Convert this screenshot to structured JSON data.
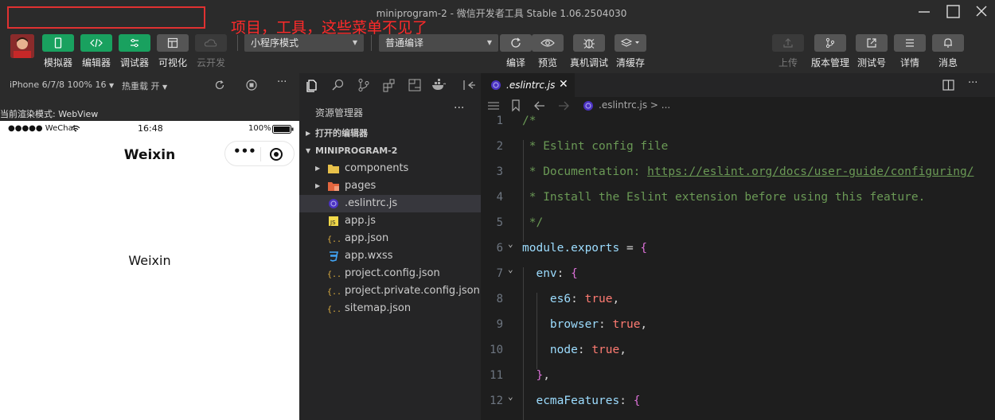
{
  "window": {
    "title": "miniprogram-2 - 微信开发者工具 Stable 1.06.2504030",
    "annotation": "项目，工具，这些菜单不见了"
  },
  "toolbar": {
    "left_buttons": [
      {
        "label": "模拟器",
        "icon": "phone-icon"
      },
      {
        "label": "编辑器",
        "icon": "code-icon"
      },
      {
        "label": "调试器",
        "icon": "debug-toggle-icon"
      },
      {
        "label": "可视化",
        "icon": "layout-icon"
      },
      {
        "label": "云开发",
        "icon": "cloud-icon"
      }
    ],
    "mode_select": "小程序模式",
    "compile_select": "普通编译",
    "center_buttons": [
      {
        "label": "编译",
        "icon": "refresh-icon"
      },
      {
        "label": "预览",
        "icon": "eye-icon"
      },
      {
        "label": "真机调试",
        "icon": "bug-icon"
      },
      {
        "label": "清缓存",
        "icon": "layers-icon"
      }
    ],
    "right_buttons": [
      {
        "label": "上传",
        "icon": "upload-icon"
      },
      {
        "label": "版本管理",
        "icon": "branch-icon"
      },
      {
        "label": "测试号",
        "icon": "external-icon"
      },
      {
        "label": "详情",
        "icon": "menu-icon"
      },
      {
        "label": "消息",
        "icon": "bell-icon"
      }
    ]
  },
  "simulator": {
    "device": "iPhone 6/7/8 100% 16",
    "hot_reload": "热重载 开",
    "more": "···",
    "render_mode": "当前渲染模式: WebView",
    "status_left": "●●●●● WeChat",
    "status_time": "16:48",
    "status_battery": "100%",
    "nav_title": "Weixin",
    "capsule_more": "•••",
    "page_text": "Weixin"
  },
  "explorer": {
    "title": "资源管理器",
    "more": "···",
    "open_editors": "打开的编辑器",
    "project": "MINIPROGRAM-2",
    "files": [
      {
        "name": "components",
        "kind": "folder",
        "selected": false
      },
      {
        "name": "pages",
        "kind": "folder-pages",
        "selected": false
      },
      {
        "name": ".eslintrc.js",
        "kind": "eslint",
        "selected": true
      },
      {
        "name": "app.js",
        "kind": "js",
        "selected": false
      },
      {
        "name": "app.json",
        "kind": "json",
        "selected": false
      },
      {
        "name": "app.wxss",
        "kind": "css",
        "selected": false
      },
      {
        "name": "project.config.json",
        "kind": "json",
        "selected": false
      },
      {
        "name": "project.private.config.json",
        "kind": "json",
        "selected": false
      },
      {
        "name": "sitemap.json",
        "kind": "json",
        "selected": false
      }
    ]
  },
  "editor": {
    "tab_name": ".eslintrc.js",
    "tab_close": "✕",
    "breadcrumb": ".eslintrc.js > ...",
    "lines": [
      {
        "n": "1",
        "text": "/*"
      },
      {
        "n": "2",
        "text": " * Eslint config file"
      },
      {
        "n": "3",
        "text": " * Documentation: ",
        "link": "https://eslint.org/docs/user-guide/configuring/"
      },
      {
        "n": "4",
        "text": " * Install the Eslint extension before using this feature."
      },
      {
        "n": "5",
        "text": " */"
      },
      {
        "n": "6",
        "text": "module.exports = {"
      },
      {
        "n": "7",
        "text": "  env: {"
      },
      {
        "n": "8",
        "text": "    es6: true,"
      },
      {
        "n": "9",
        "text": "    browser: true,"
      },
      {
        "n": "10",
        "text": "    node: true,"
      },
      {
        "n": "11",
        "text": "  },"
      },
      {
        "n": "12",
        "text": "  ecmaFeatures: {"
      }
    ]
  }
}
